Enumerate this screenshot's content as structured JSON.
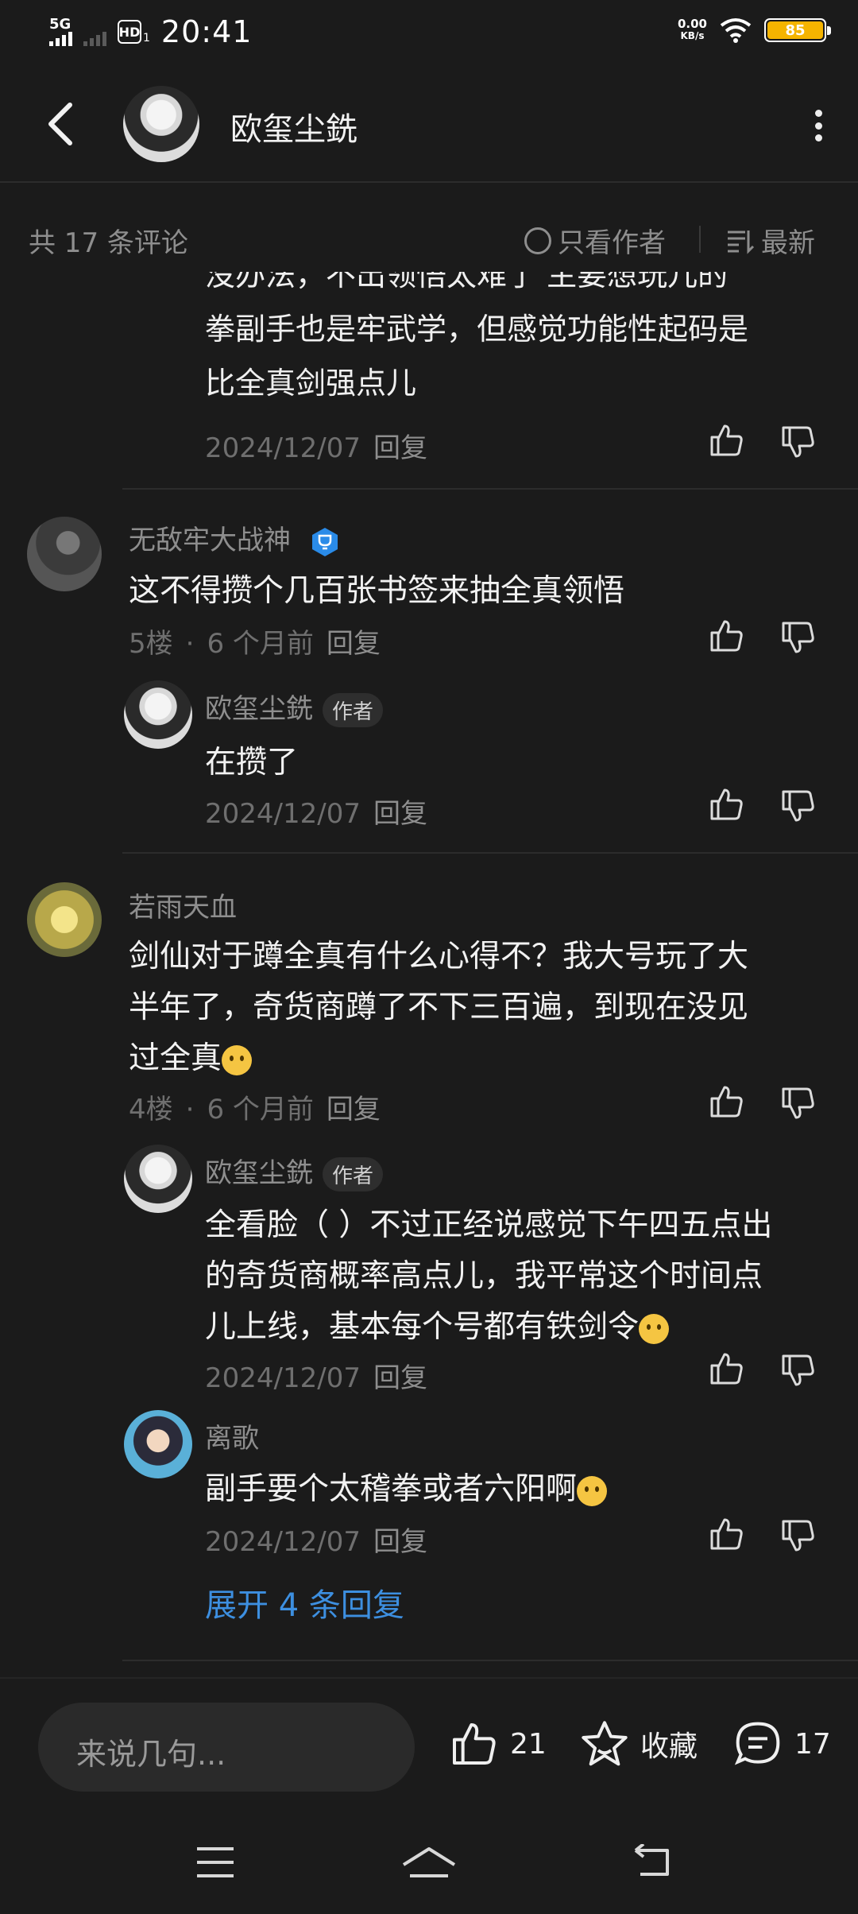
{
  "status_bar": {
    "network": "5G",
    "hd": "HD",
    "hd_sub": "1",
    "time": "20:41",
    "speed_value": "0.00",
    "speed_unit": "KB/s",
    "battery": "85"
  },
  "header": {
    "title": "欧玺尘銑"
  },
  "filter": {
    "count": "共 17 条评论",
    "only_author": "只看作者",
    "sort": "最新"
  },
  "comments": {
    "partial": {
      "line1": "没办法，不出领悟太难了 主要想玩儿的",
      "line2": "拳副手也是牢武学，但感觉功能性起码是",
      "line3": "比全真剑强点儿",
      "date": "2024/12/07",
      "reply": "回复"
    },
    "c5": {
      "user": "无敌牢大战神",
      "text": "这不得攒个几百张书签来抽全真领悟",
      "floor": "5楼",
      "time": "6 个月前",
      "reply": "回复"
    },
    "c5r1": {
      "user": "欧玺尘銑",
      "badge": "作者",
      "text": "在攒了",
      "date": "2024/12/07",
      "reply": "回复"
    },
    "c4": {
      "user": "若雨天血",
      "line1": "剑仙对于蹲全真有什么心得不？我大号玩了大",
      "line2": "半年了，奇货商蹲了不下三百遍，到现在没见",
      "line3": "过全真",
      "floor": "4楼",
      "time": "6 个月前",
      "reply": "回复"
    },
    "c4r1": {
      "user": "欧玺尘銑",
      "badge": "作者",
      "line1": "全看脸（ ）不过正经说感觉下午四五点出",
      "line2": "的奇货商概率高点儿，我平常这个时间点",
      "line3": "儿上线，基本每个号都有铁剑令",
      "date": "2024/12/07",
      "reply": "回复"
    },
    "c4r2": {
      "user": "离歌",
      "text": "副手要个太稽拳或者六阳啊",
      "date": "2024/12/07",
      "reply": "回复"
    },
    "expand": "展开 4 条回复"
  },
  "bottom_bar": {
    "input_placeholder": "来说几句...",
    "likes": "21",
    "favorite": "收藏",
    "comments": "17"
  },
  "colors": {
    "background": "#1b1b1b",
    "accent": "#3d8fe0",
    "battery": "#f5b400"
  }
}
